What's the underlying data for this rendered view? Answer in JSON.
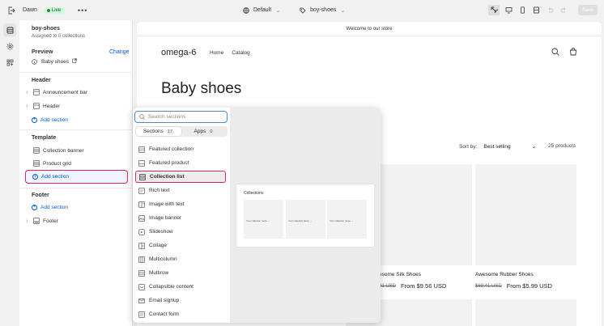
{
  "topbar": {
    "theme_name": "Dawn",
    "status": "Live",
    "more": "•••",
    "template_select": "Default",
    "page_select": "boy-shoes",
    "save_label": "Save"
  },
  "sidebar": {
    "title": "boy-shoes",
    "subtitle": "Assigned to 0 collections",
    "preview_label": "Preview",
    "change_label": "Change",
    "preview_value": "Baby shoes",
    "header_group": {
      "label": "Header",
      "items": [
        "Announcement bar",
        "Header"
      ],
      "add_label": "Add section"
    },
    "template_group": {
      "label": "Template",
      "items": [
        "Collection banner",
        "Product grid"
      ],
      "add_label": "Add section"
    },
    "footer_group": {
      "label": "Footer",
      "add_label": "Add section",
      "items": [
        "Footer"
      ]
    }
  },
  "store": {
    "announcement": "Welcome to our store",
    "logo": "omega-6",
    "nav": [
      "Home",
      "Catalog"
    ],
    "heading": "Baby shoes",
    "sort_label": "Sort by:",
    "sort_value": "Best selling",
    "product_count": "25 products",
    "products": [
      {
        "name": "esome Silk Shoes",
        "compare_price": "21 USD",
        "price": "From $9.56 USD"
      },
      {
        "name": "Awesome Rubber Shoes",
        "compare_price": "$69.41 USD",
        "price": "From $5.99 USD"
      }
    ]
  },
  "picker": {
    "search_placeholder": "Search sections",
    "tabs": [
      {
        "label": "Sections",
        "count": "17"
      },
      {
        "label": "Apps",
        "count": "0"
      }
    ],
    "items": [
      {
        "label": "Featured collection",
        "icon": "featured-collection-icon"
      },
      {
        "label": "Featured product",
        "icon": "featured-product-icon"
      },
      {
        "label": "Collection list",
        "icon": "collection-list-icon"
      },
      {
        "label": "Rich text",
        "icon": "rich-text-icon"
      },
      {
        "label": "Image with text",
        "icon": "image-with-text-icon"
      },
      {
        "label": "Image banner",
        "icon": "image-banner-icon"
      },
      {
        "label": "Slideshow",
        "icon": "slideshow-icon"
      },
      {
        "label": "Collage",
        "icon": "collage-icon"
      },
      {
        "label": "Multicolumn",
        "icon": "multicolumn-icon"
      },
      {
        "label": "Multirow",
        "icon": "multirow-icon"
      },
      {
        "label": "Collapsible content",
        "icon": "collapsible-content-icon"
      },
      {
        "label": "Email signup",
        "icon": "email-signup-icon"
      },
      {
        "label": "Contact form",
        "icon": "contact-form-icon"
      }
    ],
    "preview_title": "Collections",
    "preview_tile_label": "Your collection name →"
  },
  "colors": {
    "accent": "#005bd3",
    "highlight": "#e0245e",
    "live_badge": "#cdfed4"
  }
}
